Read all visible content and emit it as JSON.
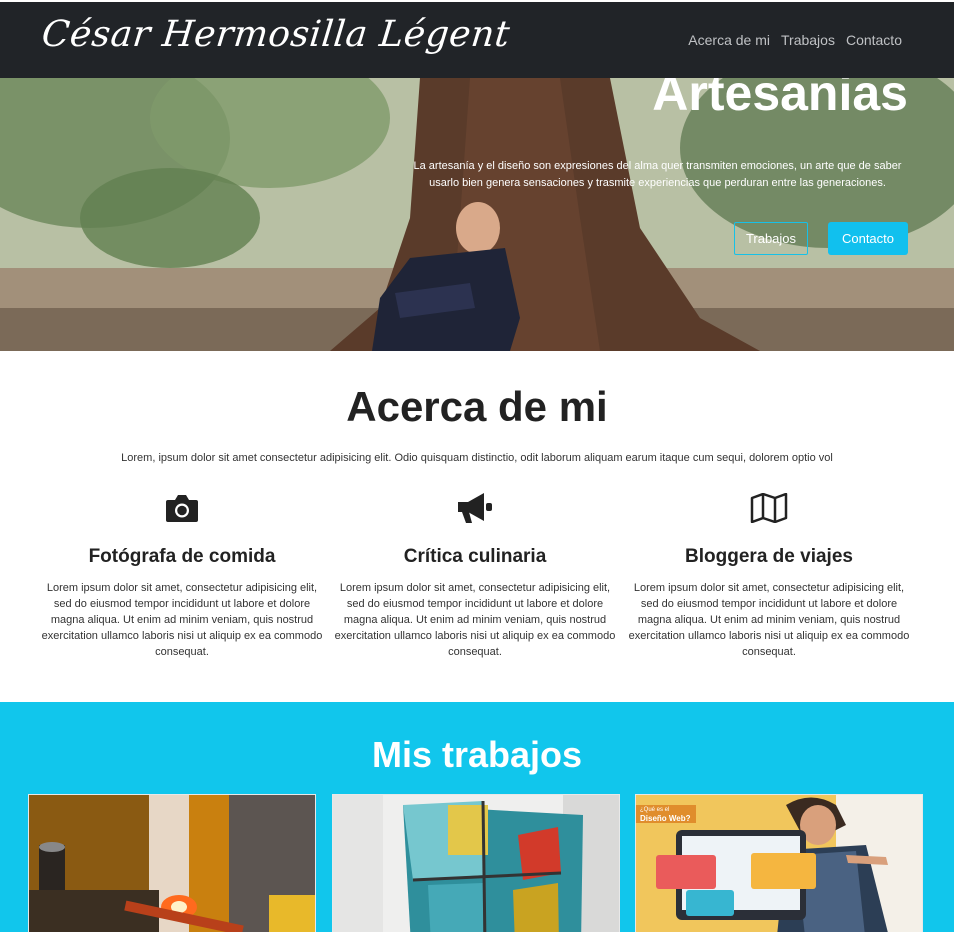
{
  "navbar": {
    "brand": "César Hermosilla Légent",
    "links": [
      "Acerca de mi",
      "Trabajos",
      "Contacto"
    ]
  },
  "hero": {
    "title": "Artesanias",
    "text": "La artesanía y el diseño son expresiones del alma quer transmiten emociones, un arte que de saber usarlo bien genera sensaciones y trasmite experiencias que perduran entre las generaciones.",
    "btn_outline": "Trabajos",
    "btn_solid": "Contacto"
  },
  "about": {
    "title": "Acerca de mi",
    "intro": "Lorem, ipsum dolor sit amet consectetur adipisicing elit. Odio quisquam distinctio, odit laborum aliquam earum itaque cum sequi, dolorem optio vol",
    "features": [
      {
        "icon": "camera-icon",
        "title": "Fotógrafa de comida",
        "text": "Lorem ipsum dolor sit amet, consectetur adipisicing elit, sed do eiusmod tempor incididunt ut labore et dolore magna aliqua. Ut enim ad minim veniam, quis nostrud exercitation ullamco laboris nisi ut aliquip ex ea commodo consequat."
      },
      {
        "icon": "megaphone-icon",
        "title": "Crítica culinaria",
        "text": "Lorem ipsum dolor sit amet, consectetur adipisicing elit, sed do eiusmod tempor incididunt ut labore et dolore magna aliqua. Ut enim ad minim veniam, quis nostrud exercitation ullamco laboris nisi ut aliquip ex ea commodo consequat."
      },
      {
        "icon": "map-icon",
        "title": "Bloggera de viajes",
        "text": "Lorem ipsum dolor sit amet, consectetur adipisicing elit, sed do eiusmod tempor incididunt ut labore et dolore magna aliqua. Ut enim ad minim veniam, quis nostrud exercitation ullamco laboris nisi ut aliquip ex ea commodo consequat."
      }
    ]
  },
  "works": {
    "title": "Mis trabajos",
    "card3_badge_line1": "¿Qué es el",
    "card3_badge_line2": "Diseño Web?"
  },
  "colors": {
    "navbar": "#212428",
    "accent": "#11c6ec"
  }
}
